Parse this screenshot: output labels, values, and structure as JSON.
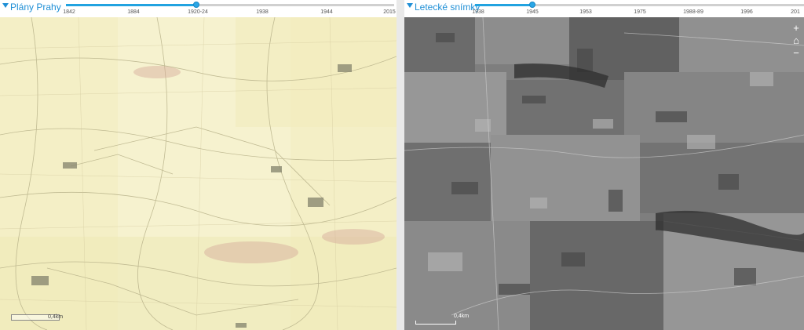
{
  "left_pane": {
    "title": "Plány Prahy",
    "slider_value": "1920-24",
    "slider_position_fraction": 0.41,
    "ticks": [
      "1842",
      "1884",
      "1920-24",
      "1938",
      "1944",
      "2015"
    ],
    "scale_label": "0,4km"
  },
  "right_pane": {
    "title": "Letecké snímky",
    "slider_value": "1945",
    "slider_position_fraction": 0.17,
    "ticks": [
      "1938",
      "1945",
      "1953",
      "1975",
      "1988-89",
      "1996",
      "201"
    ],
    "scale_label": "0,4km",
    "zoom_in": "+",
    "home": "⌂",
    "zoom_out": "−"
  },
  "colors": {
    "accent": "#1f8fd6",
    "slider_handle": "#2aa6e6",
    "historic_map_background": "#f3eec4",
    "aerial_photo_background": "#7c7c7c"
  },
  "icons": [
    "collapse-triangle-icon",
    "home-icon",
    "zoom-in-icon",
    "zoom-out-icon"
  ]
}
